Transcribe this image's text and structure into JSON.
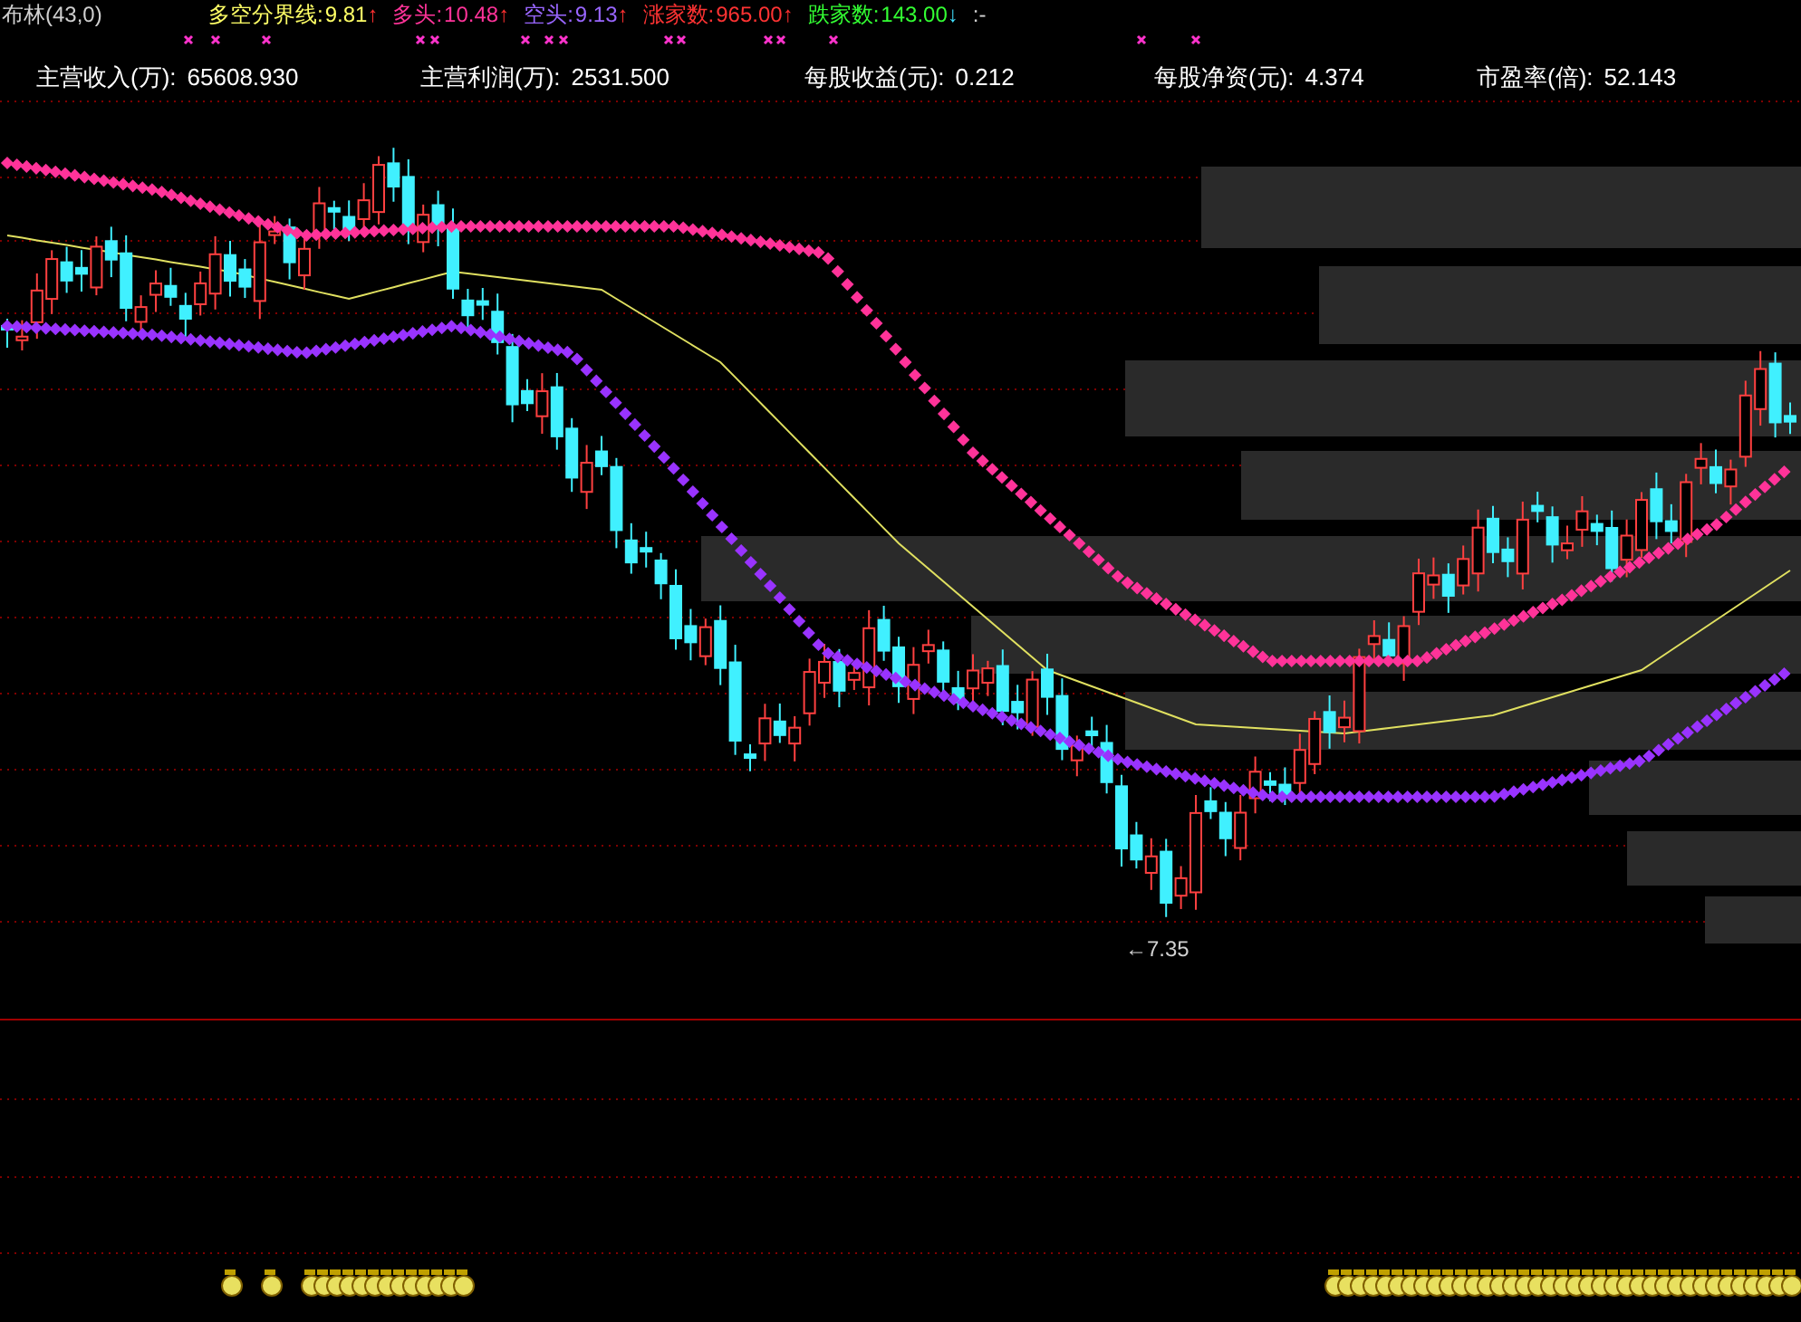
{
  "indicator": {
    "name": "布林(43,0)"
  },
  "legend": [
    {
      "label": "多空分界线:",
      "value": "9.81",
      "arrow": {
        "text": "↑",
        "color": "#ff3030"
      },
      "color": "#ffff66"
    },
    {
      "label": "多头:",
      "value": "10.48",
      "arrow": {
        "text": "↑",
        "color": "#ff3030"
      },
      "color": "#ff3399"
    },
    {
      "label": "空头:",
      "value": "9.13",
      "arrow": {
        "text": "↑",
        "color": "#ff3030"
      },
      "color": "#9966ff"
    },
    {
      "label": "涨家数:",
      "value": "965.00",
      "arrow": {
        "text": "↑",
        "color": "#ff3030"
      },
      "color": "#ff3333"
    },
    {
      "label": "跌家数:",
      "value": "143.00",
      "arrow": {
        "text": "↓",
        "color": "#40e0ff"
      },
      "color": "#33ff33"
    }
  ],
  "legend_tail": ":-",
  "fundamentals": [
    {
      "label": "主营收入(万):",
      "value": "65608.930"
    },
    {
      "label": "主营利润(万):",
      "value": "2531.500"
    },
    {
      "label": "每股收益(元):",
      "value": "0.212"
    },
    {
      "label": "每股净资(元):",
      "value": "4.374"
    },
    {
      "label": "市盈率(倍):",
      "value": "52.143"
    }
  ],
  "chart": {
    "low_label": "←7.35"
  }
}
